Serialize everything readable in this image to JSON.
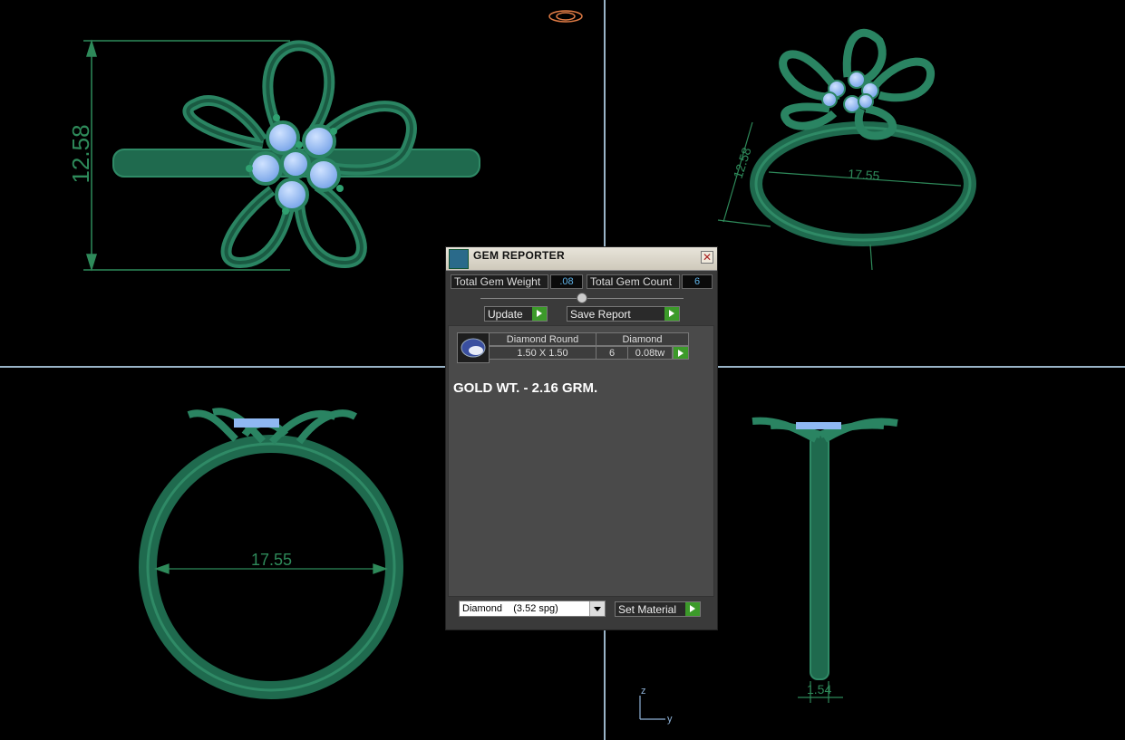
{
  "dimensions": {
    "top_left_height": "12.58",
    "top_right_height": "12.58",
    "top_right_width": "17.55",
    "bottom_left_diameter": "17.55",
    "bottom_right_thickness": "1.54"
  },
  "axes": {
    "z": "z",
    "y": "y"
  },
  "colors": {
    "metal": "#1f6a4e",
    "gem": "#8fb8f2",
    "dimension": "#2e8a5a",
    "button_arrow": "#3c9a2a"
  },
  "gem_reporter": {
    "title": "GEM REPORTER",
    "close_symbol": "✕",
    "total_gem_weight_label": "Total Gem Weight",
    "total_gem_weight_value": ".08",
    "total_gem_count_label": "Total Gem Count",
    "total_gem_count_value": "6",
    "update_label": "Update",
    "save_report_label": "Save Report",
    "table": {
      "col1_header": "Diamond Round",
      "col2_header": "Diamond",
      "size": "1.50 X 1.50",
      "count": "6",
      "weight": "0.08tw"
    },
    "note": "GOLD WT. - 2.16 GRM.",
    "material_select": "Diamond    (3.52 spg)",
    "set_material_label": "Set Material"
  }
}
